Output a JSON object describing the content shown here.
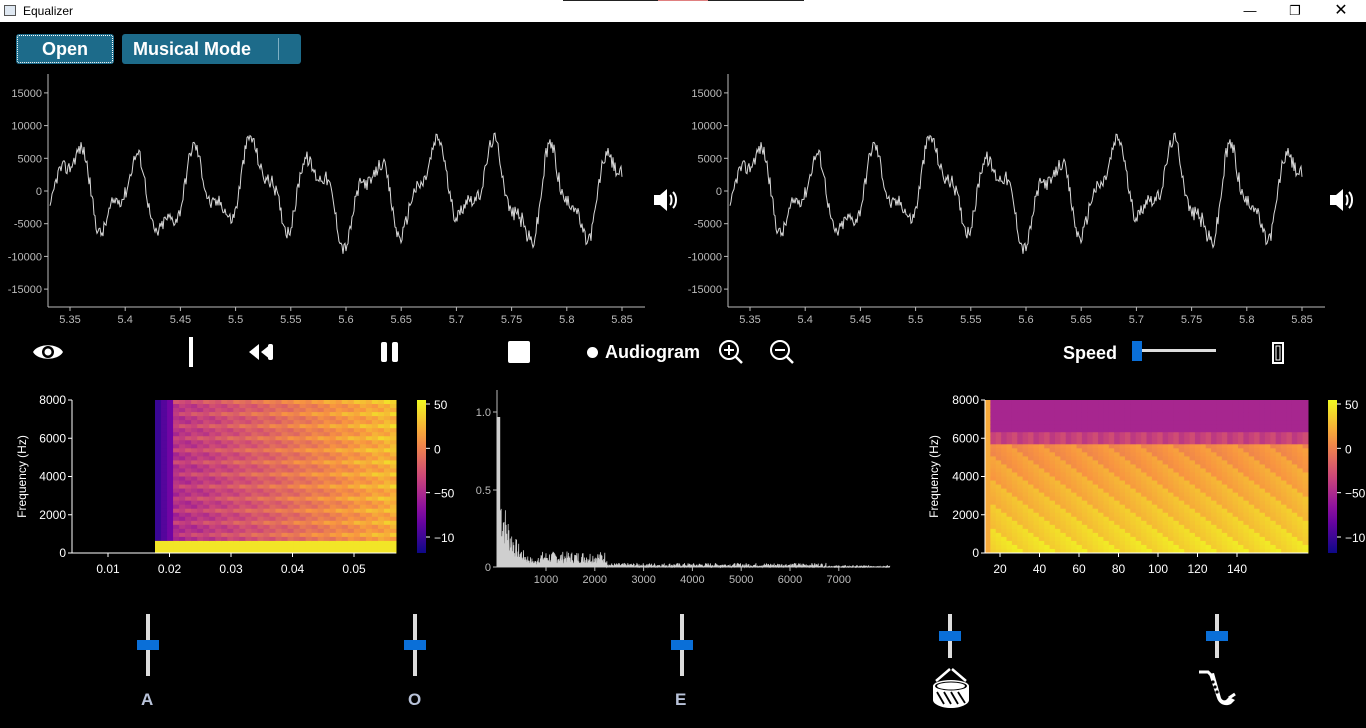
{
  "window": {
    "title": "Equalizer"
  },
  "toolbar": {
    "open_label": "Open",
    "mode_label": "Musical Mode"
  },
  "waveform": {
    "y_ticks": [
      "15000",
      "10000",
      "5000",
      "0",
      "-5000",
      "-10000",
      "-15000"
    ],
    "x_ticks": [
      "5.35",
      "5.4",
      "5.45",
      "5.5",
      "5.55",
      "5.6",
      "5.65",
      "5.7",
      "5.75",
      "5.8",
      "5.85"
    ]
  },
  "controls": {
    "audiogram_label": "Audiogram",
    "speed_label": "Speed",
    "speed_value": 0.0
  },
  "spectrogram_left": {
    "ylabel": "Frequency (Hz)",
    "y_ticks": [
      "8000",
      "6000",
      "4000",
      "2000",
      "0"
    ],
    "x_ticks": [
      "0.01",
      "0.02",
      "0.03",
      "0.04",
      "0.05"
    ],
    "cbar_ticks": [
      "50",
      "0",
      "−50",
      "−10"
    ]
  },
  "fft": {
    "y_ticks": [
      "1.0",
      "0.5",
      "0"
    ],
    "x_ticks": [
      "1000",
      "2000",
      "3000",
      "4000",
      "5000",
      "6000",
      "7000"
    ]
  },
  "spectrogram_right": {
    "ylabel": "Frequency (Hz)",
    "y_ticks": [
      "8000",
      "6000",
      "4000",
      "2000",
      "0"
    ],
    "x_ticks": [
      "20",
      "40",
      "60",
      "80",
      "100",
      "120",
      "140"
    ],
    "cbar_ticks": [
      "50",
      "0",
      "−50",
      "−10"
    ]
  },
  "bands": [
    {
      "label": "A",
      "icon": "",
      "level": 0.5
    },
    {
      "label": "O",
      "icon": "",
      "level": 0.5
    },
    {
      "label": "E",
      "icon": "",
      "level": 0.5
    },
    {
      "label": "",
      "icon": "drum-icon",
      "level": 0.5
    },
    {
      "label": "",
      "icon": "saxophone-icon",
      "level": 0.5
    }
  ],
  "colors": {
    "accent_button": "#1d6b8a",
    "slider_handle": "#0a6fd8"
  }
}
